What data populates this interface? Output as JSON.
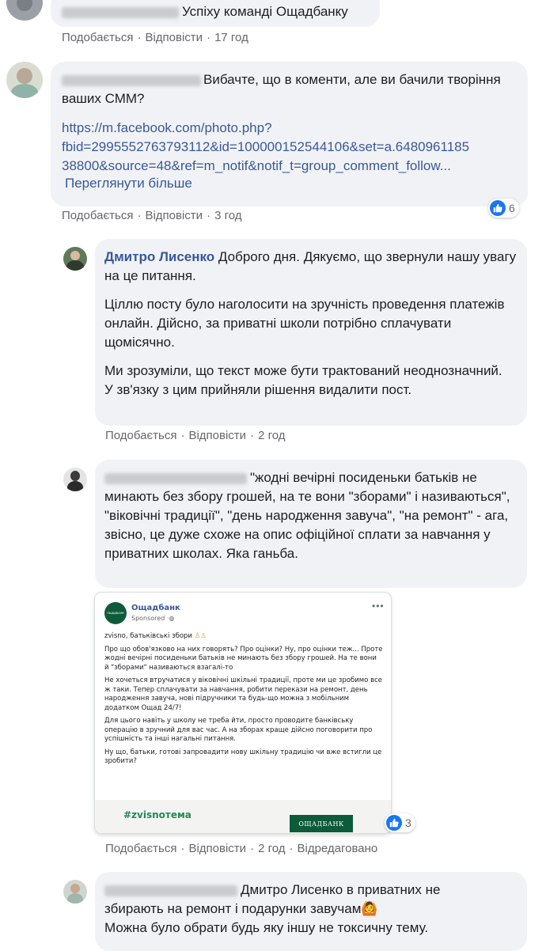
{
  "comments": [
    {
      "text": "Успіху команді Ощадбанку",
      "like_label": "Подобається",
      "reply_label": "Відповісти",
      "time": "17 год"
    },
    {
      "text": "Вибачте, що в коменти, але ви бачили творіння ваших СММ?",
      "link_line1": "https://m.facebook.com/photo.php?",
      "link_line2": "fbid=2995552763793112&id=100000152544106&set=a.6480961185",
      "link_line3": "38800&source=48&ref=m_notif&notif_t=group_comment_follow...",
      "see_more": "Переглянути більше",
      "like_label": "Подобається",
      "reply_label": "Відповісти",
      "time": "3 год",
      "reaction_count": "6"
    }
  ],
  "replies": [
    {
      "author": "Дмитро Лисенко",
      "p1": "Доброго дня. Дякуємо, що звернули нашу увагу на це питання.",
      "p2": "Ціллю посту було наголосити на зручність проведення платежів онлайн. Дійсно, за приватні школи потрібно сплачувати щомісячно.",
      "p3a": "Ми зрозуміли, що текст може бути трактований неоднозначний.",
      "p3b": "У зв'язку з цим прийняли рішення видалити пост.",
      "like_label": "Подобається",
      "reply_label": "Відповісти",
      "time": "2 год"
    },
    {
      "text": "\"жодні вечірні посиденьки батьків не минають без збору грошей, на те вони \"зборами\" і називаються\", \"віковічні традиції\", \"день народження завуча\", \"на ремонт\" - ага, звісно, це дуже схоже на опис офіційної сплати за навчання у приватних школах. Яка ганьба.",
      "like_label": "Подобається",
      "reply_label": "Відповісти",
      "time": "2 год",
      "edited": "Відредаговано",
      "reaction_count": "3",
      "attached_post": {
        "page_name": "Ощадбанк",
        "sponsored": "Sponsored",
        "logo_text": "ОЩАДБАНК",
        "title": "zvisno, батьківські збори",
        "para1": "Про що обов'язково на них говорять? Про оцінки? Ну, про оцінки теж... Проте жодні вечірні посиденьки батьків не минають без збору грошей. На те вони й \"зборами\" називаються взагалі-то",
        "para2": "Не хочеться втручатися у віковічні шкільні традиції, проте ми це зробимо все ж таки. Тепер сплачувати за навчання, робити перекази на ремонт, день народження завуча, нові підручники та будь-що можна з мобільним додатком Ощад 24/7!",
        "para3": "Для цього навіть у школу не треба йти, просто проводите банківську операцію в зручний для вас час. А на зборах краще дійсно поговорити про успішність та інші нагальні питання.",
        "para4": "Ну що, батьки, готові запровадити нову шкільну традицію чи вже встигли це зробити?",
        "hashtag": "#zvisnoтема",
        "brand": "ОЩАДБАНК"
      }
    },
    {
      "mention": "Дмитро Лисенко",
      "text_line1": " в приватних не",
      "text_line2": "збирають на ремонт і подарунки завучам",
      "text_line3": "Можна було обрати будь яку іншу не токсичну тему."
    }
  ],
  "colors": {
    "bubble": "#f0f2f5",
    "link": "#385898",
    "meta": "#65676b",
    "like_blue": "#1877f2",
    "brand_green": "#0e5b3c"
  }
}
